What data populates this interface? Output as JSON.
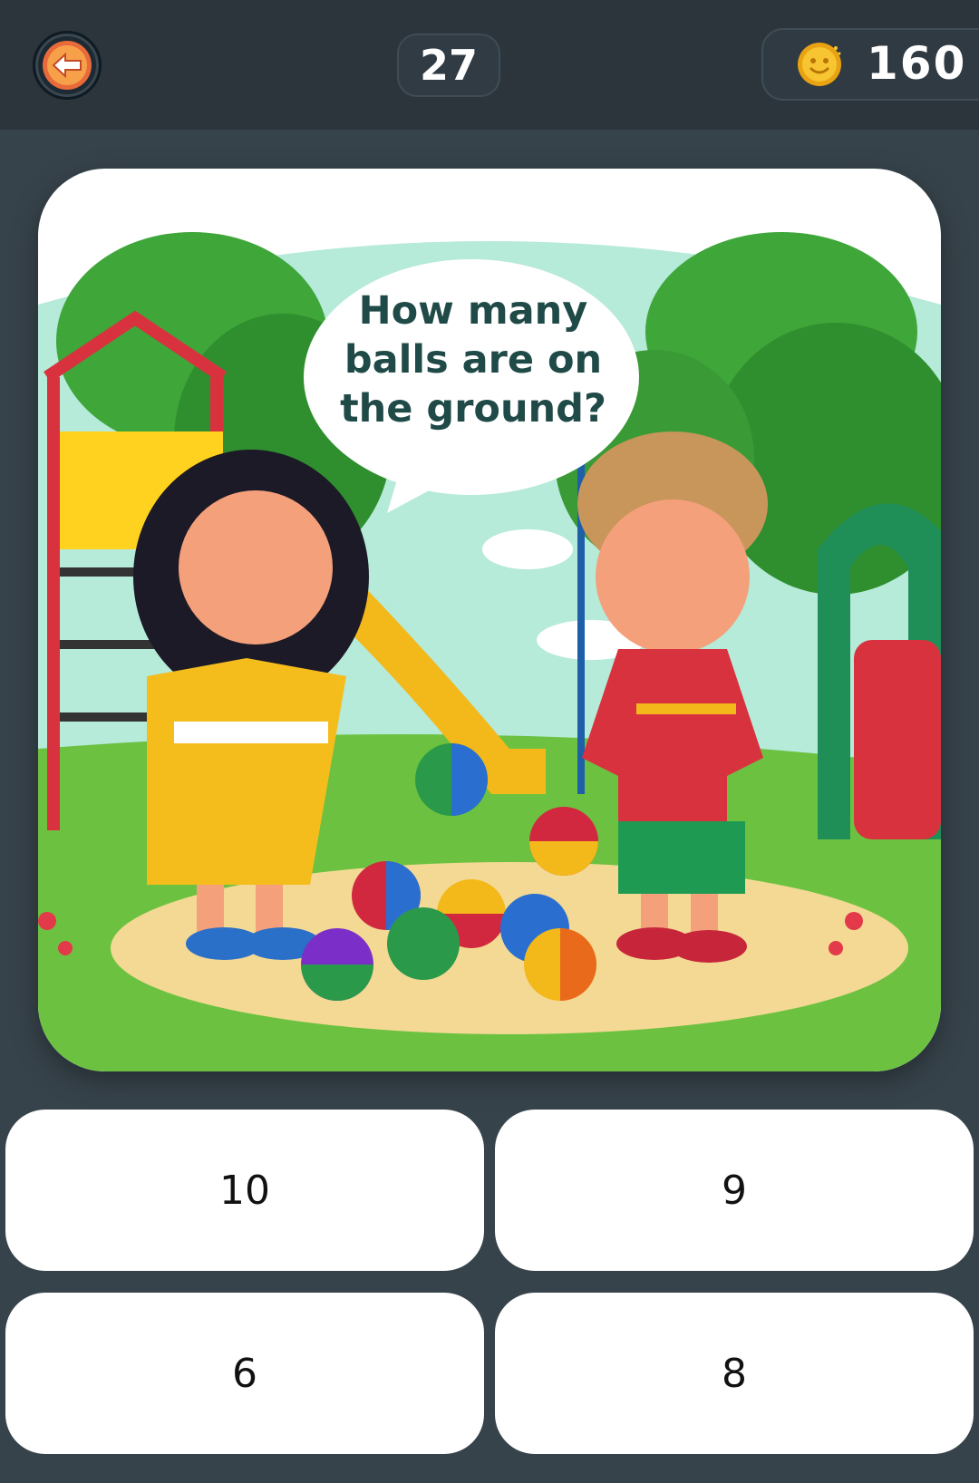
{
  "header": {
    "back_icon": "back-arrow-icon",
    "level": "27",
    "coin_icon": "smiley-coin-icon",
    "coins": "160"
  },
  "question": {
    "text": "How many balls are on the ground?"
  },
  "answers": [
    {
      "label": "10"
    },
    {
      "label": "9"
    },
    {
      "label": "6"
    },
    {
      "label": "8"
    }
  ],
  "colors": {
    "background": "#37434b",
    "topbar": "#2c353c",
    "card": "#ffffff",
    "bubble_text": "#1f4a47"
  }
}
